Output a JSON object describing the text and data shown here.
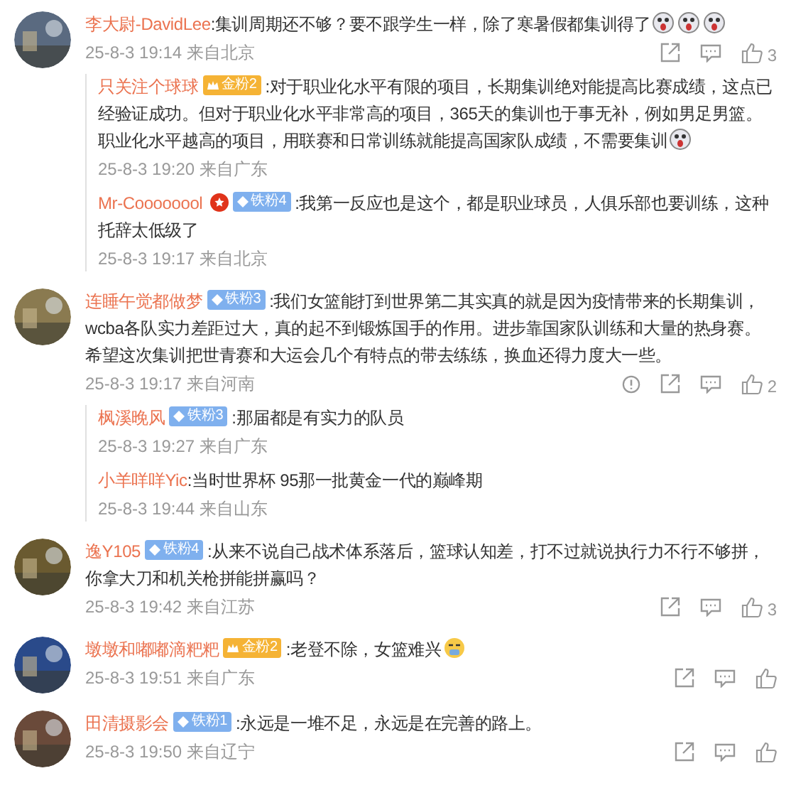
{
  "comments": [
    {
      "user": "李大尉-DavidLee",
      "text": ":集训周期还不够？要不跟学生一样，除了寒暑假都集训得了",
      "emojis": [
        {
          "kind": "laugh"
        },
        {
          "kind": "laugh"
        },
        {
          "kind": "laugh"
        }
      ],
      "time": "25-8-3 19:14 来自北京",
      "report": false,
      "likes": "3",
      "replies": [
        {
          "user": "只关注个球球",
          "badge": {
            "kind": "gold",
            "label": "金粉2"
          },
          "text": ":对于职业化水平有限的项目，长期集训绝对能提高比赛成绩，这点已经验证成功。但对于职业化水平非常高的项目，365天的集训也于事无补，例如男足男篮。职业化水平越高的项目，用联赛和日常训练就能提高国家队成绩，不需要集训",
          "emojis": [
            {
              "kind": "laugh"
            }
          ],
          "time": "25-8-3 19:20 来自广东"
        },
        {
          "user": "Mr-Coooooool",
          "vip": true,
          "badge": {
            "kind": "iron",
            "label": "铁粉4"
          },
          "text": ":我第一反应也是这个，都是职业球员，人俱乐部也要训练，这种托辞太低级了",
          "time": "25-8-3 19:17 来自北京"
        }
      ]
    },
    {
      "user": "连睡午觉都做梦",
      "badge": {
        "kind": "iron",
        "label": "铁粉3"
      },
      "text": ":我们女篮能打到世界第二其实真的就是因为疫情带来的长期集训，wcba各队实力差距过大，真的起不到锻炼国手的作用。进步靠国家队训练和大量的热身赛。希望这次集训把世青赛和大运会几个有特点的带去练练，换血还得力度大一些。",
      "time": "25-8-3 19:17 来自河南",
      "report": true,
      "likes": "2",
      "replies": [
        {
          "user": "枫溪晚风",
          "badge": {
            "kind": "iron",
            "label": "铁粉3"
          },
          "text": ":那届都是有实力的队员",
          "time": "25-8-3 19:27 来自广东"
        },
        {
          "user": "小羊咩咩Yic",
          "text": ":当时世界杯 95那一批黄金一代的巅峰期",
          "time": "25-8-3 19:44 来自山东"
        }
      ]
    },
    {
      "user": "逸Y105",
      "badge": {
        "kind": "iron",
        "label": "铁粉4"
      },
      "text": ":从来不说自己战术体系落后，篮球认知差，打不过就说执行力不行不够拼，你拿大刀和机关枪拼能拼赢吗？",
      "time": "25-8-3 19:42 来自江苏",
      "report": false,
      "likes": "3"
    },
    {
      "user": "墩墩和嘟嘟滴粑粑",
      "badge": {
        "kind": "gold",
        "label": "金粉2"
      },
      "text": ":老登不除，女篮难兴",
      "emojis": [
        {
          "kind": "sweat"
        }
      ],
      "time": "25-8-3 19:51 来自广东",
      "report": false
    },
    {
      "user": "田清摄影会",
      "badge": {
        "kind": "iron",
        "label": "铁粉1"
      },
      "text": ":永远是一堆不足，永远是在完善的路上。",
      "time": "25-8-3 19:50 来自辽宁",
      "report": false
    }
  ]
}
